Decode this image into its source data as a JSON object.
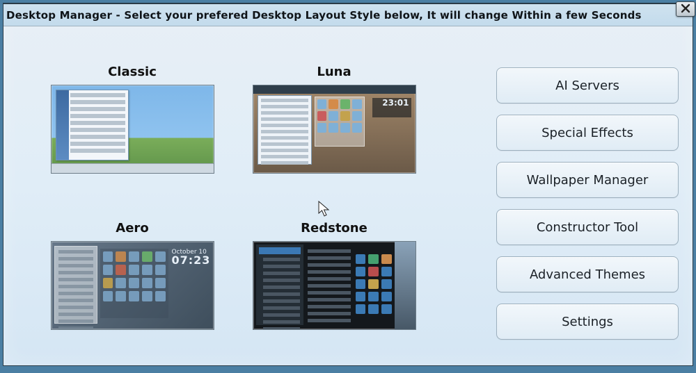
{
  "window": {
    "title": "Desktop Manager - Select your prefered Desktop Layout Style below, It will change Within a few Seconds"
  },
  "layouts": [
    {
      "id": "classic",
      "label": "Classic"
    },
    {
      "id": "luna",
      "label": "Luna",
      "clock_date": "",
      "clock_time": "23:01"
    },
    {
      "id": "aero",
      "label": "Aero",
      "clock_date": "October 10",
      "clock_time": "07:23"
    },
    {
      "id": "redstone",
      "label": "Redstone"
    }
  ],
  "sidebar": {
    "buttons": [
      {
        "id": "ai-servers",
        "label": "AI Servers"
      },
      {
        "id": "special-effects",
        "label": "Special Effects"
      },
      {
        "id": "wallpaper-manager",
        "label": "Wallpaper Manager"
      },
      {
        "id": "constructor-tool",
        "label": "Constructor Tool"
      },
      {
        "id": "advanced-themes",
        "label": "Advanced Themes"
      },
      {
        "id": "settings",
        "label": "Settings"
      }
    ]
  }
}
